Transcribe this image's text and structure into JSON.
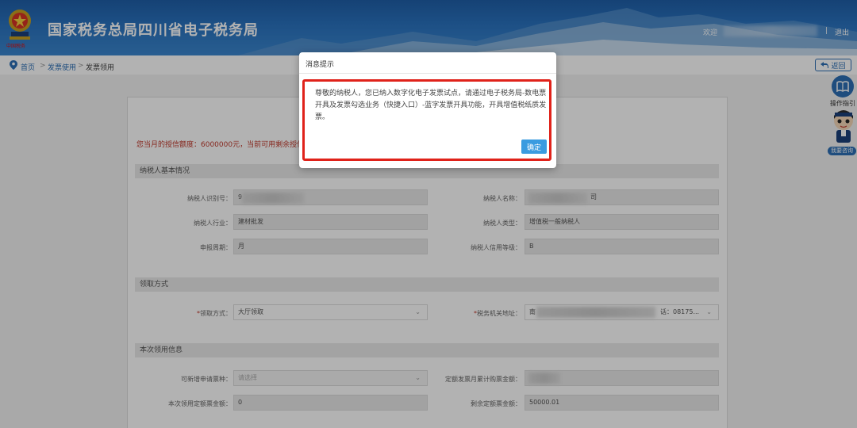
{
  "header": {
    "title": "国家税务总局四川省电子税务局",
    "emblem_sub": "中国税务",
    "welcome": "欢迎",
    "separator": "|",
    "logout": "退出",
    "colors": {
      "bar": "#2a73c0"
    }
  },
  "breadcrumb": {
    "home": "首页",
    "sep": ">",
    "invoice_use": "发票使用",
    "current": "发票领用"
  },
  "back_button": {
    "label": "返回",
    "icon": "return-arrow-icon"
  },
  "side": {
    "guide_label": "操作指引",
    "guide_icon": "book-icon",
    "assistant_label": "我要咨询",
    "assistant_icon": "mascot-icon"
  },
  "form": {
    "quota_text": "您当月的授信额度：6000000元，当前可用剩余授信",
    "sections": {
      "basic": "纳税人基本情况",
      "method": "领取方式",
      "current": "本次领用信息"
    },
    "fields": {
      "taxpayer_id_label": "纳税人识别号：",
      "taxpayer_id_value": "9",
      "taxpayer_name_label": "纳税人名称：",
      "taxpayer_name_value": "司",
      "industry_label": "纳税人行业：",
      "industry_value": "建材批发",
      "type_label": "纳税人类型：",
      "type_value": "增值税一般纳税人",
      "period_label": "申报周期：",
      "period_value": "月",
      "credit_label": "纳税人信用等级：",
      "credit_value": "B",
      "method_label": "领取方式：",
      "method_value": "大厅领取",
      "office_label": "税务机关地址：",
      "office_value_start": "南",
      "office_value_end": "话：08175...",
      "addable_label": "可新增申请票种：",
      "addable_placeholder": "请选择",
      "monthly_total_label": "定额发票月累计购票金额：",
      "this_amount_label": "本次领用定额票金额：",
      "this_amount_value": "0",
      "remaining_label": "剩余定额票金额：",
      "remaining_value": "50000.01"
    },
    "required_mark": "*",
    "dropdown_arrow": "⌄"
  },
  "modal": {
    "title": "消息提示",
    "message": "尊敬的纳税人，您已纳入数字化电子发票试点，请通过电子税务局-数电票开具及发票勾选业务（快捷入口）-蓝字发票开具功能，开具增值税纸质发票。",
    "ok": "确定",
    "colors": {
      "frame": "#e0221a",
      "button": "#3a9be0"
    }
  }
}
